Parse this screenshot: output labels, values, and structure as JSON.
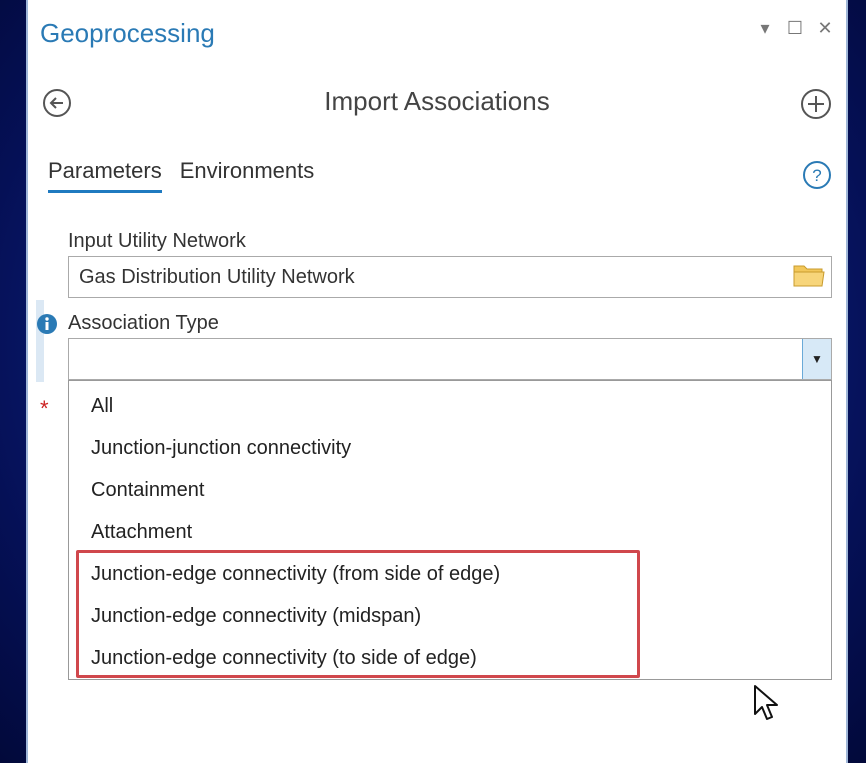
{
  "window": {
    "title": "Geoprocessing",
    "controls": [
      "▾",
      "☐",
      "✕"
    ]
  },
  "tool": {
    "title": "Import Associations",
    "back_icon": "back-arrow-icon",
    "add_icon": "add-icon"
  },
  "tabs": [
    {
      "label": "Parameters",
      "active": true
    },
    {
      "label": "Environments",
      "active": false
    }
  ],
  "params": {
    "input_network": {
      "label": "Input Utility Network",
      "value": "Gas Distribution Utility Network"
    },
    "association_type": {
      "label": "Association Type",
      "value": "",
      "options": [
        "All",
        "Junction-junction connectivity",
        "Containment",
        "Attachment",
        "Junction-edge connectivity (from side of edge)",
        "Junction-edge connectivity (midspan)",
        "Junction-edge connectivity (to side of edge)"
      ]
    }
  },
  "required_marker": "*",
  "colors": {
    "accent": "#1f7ac0",
    "title_blue": "#2a7ab5",
    "highlight_red": "#d0474c",
    "background": "#0b1f7a"
  }
}
